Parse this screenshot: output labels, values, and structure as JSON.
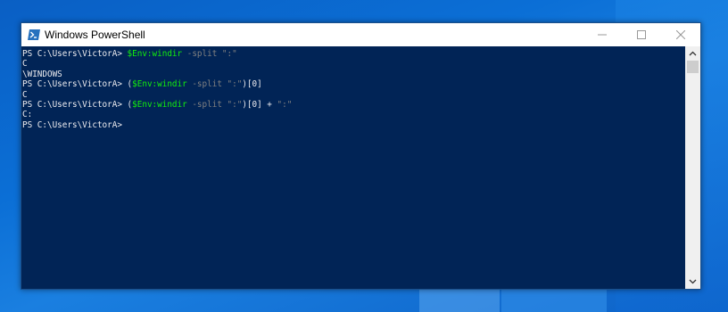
{
  "window": {
    "title": "Windows PowerShell",
    "icon": "powershell-icon",
    "controls": [
      "minimize-icon",
      "maximize-icon",
      "close-icon"
    ]
  },
  "console": {
    "lines": [
      [
        {
          "t": "PS C:\\Users\\VictorA> ",
          "c": "out"
        },
        {
          "t": "$Env:windir",
          "c": "var"
        },
        {
          "t": " -split ",
          "c": "param"
        },
        {
          "t": "\":\"",
          "c": "str"
        }
      ],
      [
        {
          "t": "C",
          "c": "out"
        }
      ],
      [
        {
          "t": "\\WINDOWS",
          "c": "out"
        }
      ],
      [
        {
          "t": "PS C:\\Users\\VictorA> ",
          "c": "out"
        },
        {
          "t": "(",
          "c": "out"
        },
        {
          "t": "$Env:windir",
          "c": "var"
        },
        {
          "t": " -split ",
          "c": "param"
        },
        {
          "t": "\":\"",
          "c": "str"
        },
        {
          "t": ")[0]",
          "c": "out"
        }
      ],
      [
        {
          "t": "C",
          "c": "out"
        }
      ],
      [
        {
          "t": "PS C:\\Users\\VictorA> ",
          "c": "out"
        },
        {
          "t": "(",
          "c": "out"
        },
        {
          "t": "$Env:windir",
          "c": "var"
        },
        {
          "t": " -split ",
          "c": "param"
        },
        {
          "t": "\":\"",
          "c": "str"
        },
        {
          "t": ")[0] + ",
          "c": "out"
        },
        {
          "t": "\":\"",
          "c": "str"
        }
      ],
      [
        {
          "t": "C:",
          "c": "out"
        }
      ],
      [
        {
          "t": "PS C:\\Users\\VictorA>",
          "c": "out"
        }
      ]
    ]
  },
  "colors": {
    "console_bg": "#012456",
    "text": "#eeedf0",
    "variable": "#13f00c",
    "operator": "#808080"
  }
}
